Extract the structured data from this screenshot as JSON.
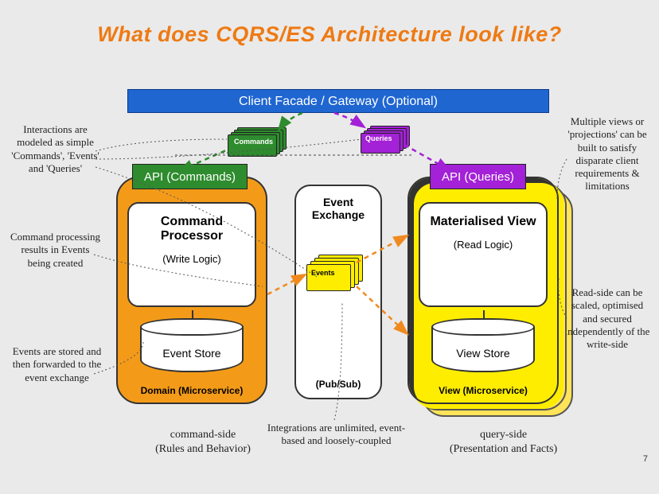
{
  "title": "What does CQRS/ES Architecture look like?",
  "page_number": "7",
  "gateway": {
    "label": "Client Facade / Gateway (Optional)"
  },
  "write_side": {
    "api_label": "API (Commands)",
    "processor_title": "Command Processor",
    "processor_sub": "(Write Logic)",
    "store_label": "Event Store",
    "footer": "Domain (Microservice)"
  },
  "read_side": {
    "api_label": "API (Queries)",
    "processor_title": "Materialised View",
    "processor_sub": "(Read Logic)",
    "store_label": "View Store",
    "footer": "View (Microservice)"
  },
  "exchange": {
    "title": "Event Exchange",
    "footer": "(Pub/Sub)"
  },
  "stacks": {
    "commands_label": "Commands",
    "queries_label": "Queries",
    "events_label": "Events"
  },
  "notes": {
    "left1": "Interactions are modeled as simple 'Commands', 'Events' and 'Queries'",
    "left2": "Command processing results in Events being created",
    "left3": "Events are stored and then forwarded to the event exchange",
    "right1": "Multiple views or 'projections' can be built to satisfy disparate client requirements & limitations",
    "right2": "Read-side can be scaled, optimised and secured independently of the write-side",
    "bottom_left": "command-side\n(Rules and Behavior)",
    "bottom_mid": "Integrations are unlimited, event-based and loosely-coupled",
    "bottom_right": "query-side\n(Presentation and Facts)"
  },
  "colors": {
    "title": "#ee7a13",
    "gateway": "#1f66d1",
    "command": "#2e8c2e",
    "query": "#a321d6",
    "event": "#ffed00",
    "write_svc": "#f39b18",
    "read_svc": "#ffed00"
  }
}
